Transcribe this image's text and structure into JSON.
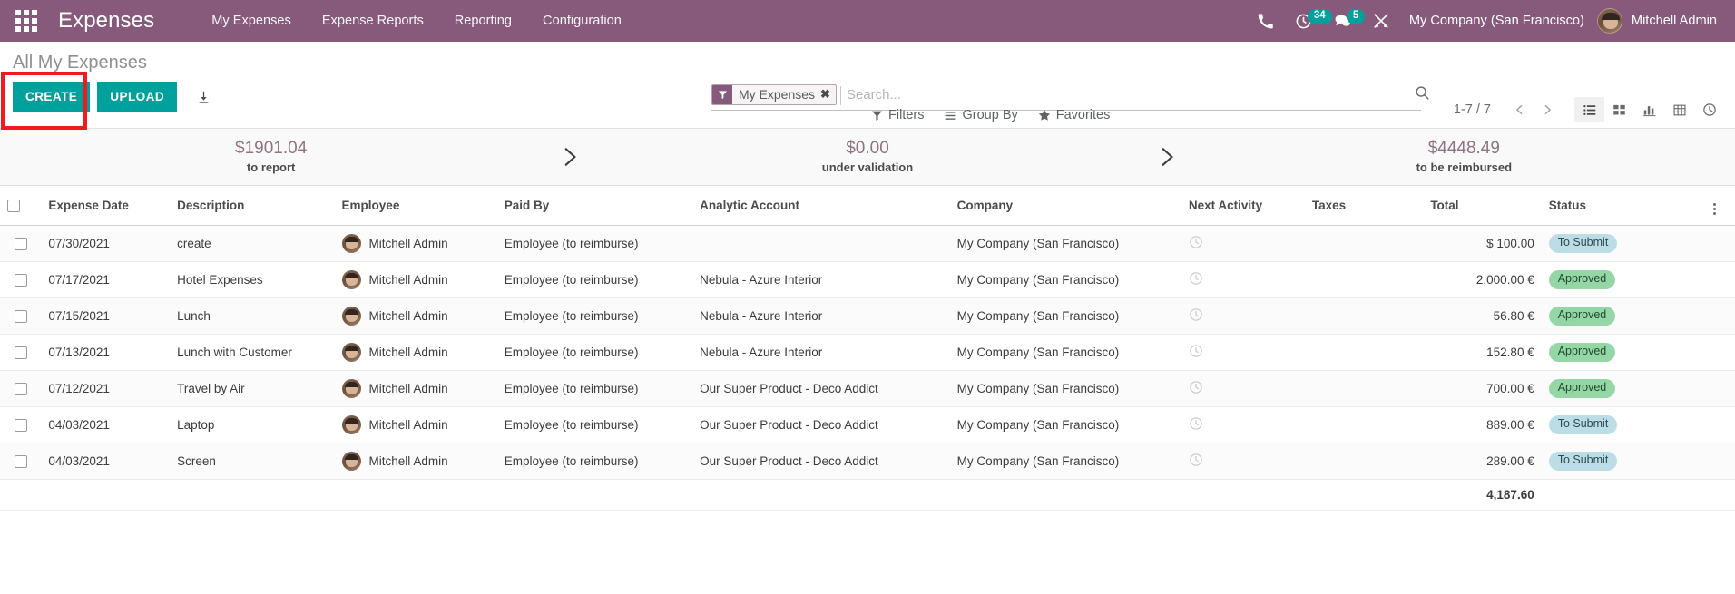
{
  "navbar": {
    "apps_icon": "apps-grid-icon",
    "brand": "Expenses",
    "menu": [
      {
        "label": "My Expenses"
      },
      {
        "label": "Expense Reports"
      },
      {
        "label": "Reporting"
      },
      {
        "label": "Configuration"
      }
    ],
    "icons": {
      "phone": "phone-icon",
      "activity": "clock-activity-icon",
      "activity_count": "34",
      "messages": "chat-bubble-icon",
      "messages_count": "5",
      "debug": "wrench-tools-icon"
    },
    "company": "My Company (San Francisco)",
    "user": "Mitchell Admin",
    "accent": "#875a7b",
    "badge_color": "#00a09d"
  },
  "control_panel": {
    "title": "All My Expenses",
    "create_label": "CREATE",
    "upload_label": "UPLOAD",
    "download_icon": "download-icon",
    "highlight_color": "#f5191f",
    "primary_color": "#00a09d",
    "search": {
      "facet_label": "My Expenses",
      "facet_icon": "filter-funnel-icon",
      "facet_remove_icon": "close-x-icon",
      "placeholder": "Search...",
      "value": "",
      "magnifier_icon": "search-icon"
    },
    "filters": [
      {
        "label": "Filters",
        "icon": "filter-funnel-icon"
      },
      {
        "label": "Group By",
        "icon": "hamburger-lines-icon"
      },
      {
        "label": "Favorites",
        "icon": "star-icon"
      }
    ],
    "pager": {
      "range": "1-7 / 7",
      "prev_icon": "chevron-left-icon",
      "next_icon": "chevron-right-icon"
    },
    "views": [
      {
        "name": "list",
        "icon": "list-view-icon",
        "active": true
      },
      {
        "name": "kanban",
        "icon": "kanban-view-icon",
        "active": false
      },
      {
        "name": "graph",
        "icon": "bar-chart-view-icon",
        "active": false
      },
      {
        "name": "pivot",
        "icon": "pivot-table-view-icon",
        "active": false
      },
      {
        "name": "activity",
        "icon": "clock-view-icon",
        "active": false
      }
    ]
  },
  "dashboard": {
    "cells": [
      {
        "value": "$1901.04",
        "label": "to report"
      },
      {
        "value": "$0.00",
        "label": "under validation"
      },
      {
        "value": "$4448.49",
        "label": "to be reimbursed"
      }
    ],
    "arrow_icon": "chevron-right-icon"
  },
  "table": {
    "columns": [
      "Expense Date",
      "Description",
      "Employee",
      "Paid By",
      "Analytic Account",
      "Company",
      "Next Activity",
      "Taxes",
      "Total",
      "Status"
    ],
    "optional_columns_icon": "vertical-dots-icon",
    "rows": [
      {
        "date": "07/30/2021",
        "description": "create",
        "employee": "Mitchell Admin",
        "paid_by": "Employee (to reimburse)",
        "analytic_account": "",
        "company": "My Company (San Francisco)",
        "next_activity": "clock-icon",
        "taxes": "",
        "total": "$ 100.00",
        "status": "To Submit",
        "status_kind": "to-submit"
      },
      {
        "date": "07/17/2021",
        "description": "Hotel Expenses",
        "employee": "Mitchell Admin",
        "paid_by": "Employee (to reimburse)",
        "analytic_account": "Nebula - Azure Interior",
        "company": "My Company (San Francisco)",
        "next_activity": "clock-icon",
        "taxes": "",
        "total": "2,000.00 €",
        "status": "Approved",
        "status_kind": "approved"
      },
      {
        "date": "07/15/2021",
        "description": "Lunch",
        "employee": "Mitchell Admin",
        "paid_by": "Employee (to reimburse)",
        "analytic_account": "Nebula - Azure Interior",
        "company": "My Company (San Francisco)",
        "next_activity": "clock-icon",
        "taxes": "",
        "total": "56.80 €",
        "status": "Approved",
        "status_kind": "approved"
      },
      {
        "date": "07/13/2021",
        "description": "Lunch with Customer",
        "employee": "Mitchell Admin",
        "paid_by": "Employee (to reimburse)",
        "analytic_account": "Nebula - Azure Interior",
        "company": "My Company (San Francisco)",
        "next_activity": "clock-icon",
        "taxes": "",
        "total": "152.80 €",
        "status": "Approved",
        "status_kind": "approved"
      },
      {
        "date": "07/12/2021",
        "description": "Travel by Air",
        "employee": "Mitchell Admin",
        "paid_by": "Employee (to reimburse)",
        "analytic_account": "Our Super Product - Deco Addict",
        "company": "My Company (San Francisco)",
        "next_activity": "clock-icon",
        "taxes": "",
        "total": "700.00 €",
        "status": "Approved",
        "status_kind": "approved"
      },
      {
        "date": "04/03/2021",
        "description": "Laptop",
        "employee": "Mitchell Admin",
        "paid_by": "Employee (to reimburse)",
        "analytic_account": "Our Super Product - Deco Addict",
        "company": "My Company (San Francisco)",
        "next_activity": "clock-icon",
        "taxes": "",
        "total": "889.00 €",
        "status": "To Submit",
        "status_kind": "to-submit"
      },
      {
        "date": "04/03/2021",
        "description": "Screen",
        "employee": "Mitchell Admin",
        "paid_by": "Employee (to reimburse)",
        "analytic_account": "Our Super Product - Deco Addict",
        "company": "My Company (San Francisco)",
        "next_activity": "clock-icon",
        "taxes": "",
        "total": "289.00 €",
        "status": "To Submit",
        "status_kind": "to-submit"
      }
    ],
    "footer": {
      "total": "4,187.60"
    }
  }
}
